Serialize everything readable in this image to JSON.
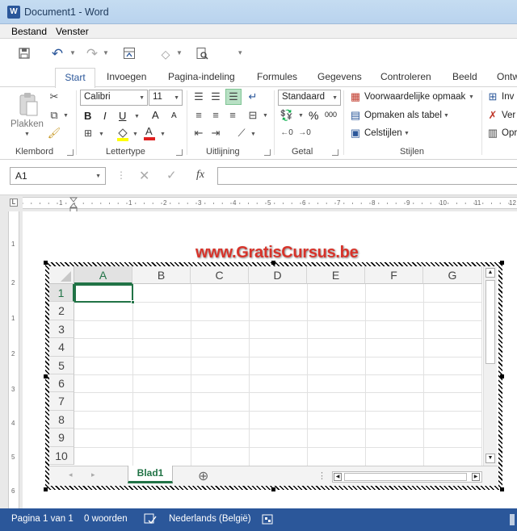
{
  "window": {
    "title": "Document1 - Word",
    "app_icon_letter": "W"
  },
  "menu": {
    "items": [
      "Bestand",
      "Venster"
    ]
  },
  "tabs": [
    "Start",
    "Invoegen",
    "Pagina-indeling",
    "Formules",
    "Gegevens",
    "Controleren",
    "Beeld",
    "Ontw"
  ],
  "ribbon": {
    "clipboard": {
      "paste_label": "Plakken",
      "group_label": "Klembord"
    },
    "font": {
      "name": "Calibri",
      "size": "11",
      "bold": "B",
      "italic": "I",
      "underline": "U",
      "grow": "A",
      "shrink": "A",
      "font_color_letter": "A",
      "group_label": "Lettertype"
    },
    "alignment": {
      "group_label": "Uitlijning"
    },
    "number": {
      "format": "Standaard",
      "percent": "%",
      "thousands": "000",
      "group_label": "Getal"
    },
    "styles": {
      "conditional": "Voorwaardelijke opmaak",
      "as_table": "Opmaken als tabel",
      "cell_styles": "Celstijlen",
      "group_label": "Stijlen"
    },
    "cells": {
      "insert": "Inv",
      "delete": "Ver",
      "format": "Opr"
    }
  },
  "formula_bar": {
    "name_box": "A1",
    "fx": "fx"
  },
  "ruler_numbers": [
    "1",
    "1",
    "2",
    "3",
    "4",
    "5",
    "6",
    "7",
    "8",
    "9",
    "10",
    "11",
    "12"
  ],
  "vruler_numbers": [
    "1",
    "2",
    "1",
    "2",
    "3",
    "4",
    "5",
    "6"
  ],
  "watermark": "www.GratisCursus.be",
  "sheet": {
    "columns": [
      "A",
      "B",
      "C",
      "D",
      "E",
      "F",
      "G"
    ],
    "rows": [
      "1",
      "2",
      "3",
      "4",
      "5",
      "6",
      "7",
      "8",
      "9",
      "10"
    ],
    "tab_name": "Blad1",
    "add_sheet": "⊕"
  },
  "status": {
    "page": "Pagina 1 van 1",
    "words": "0 woorden",
    "language": "Nederlands (België)"
  },
  "colors": {
    "accent": "#2b579a",
    "excel_green": "#217346",
    "watermark": "#d8332a"
  }
}
